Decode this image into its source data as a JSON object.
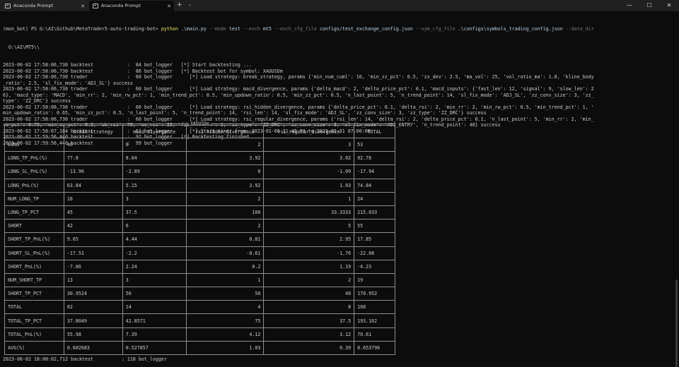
{
  "tabs": [
    {
      "label": "Anaconda Prompt",
      "active": false
    },
    {
      "label": "Anaconda Prompt",
      "active": true
    }
  ],
  "tabbar": {
    "new_tab": "+",
    "dropdown": "⌄"
  },
  "window_controls": {
    "minimize": "—",
    "maximize": "☐",
    "close": "✕"
  },
  "terminal": {
    "prompt": "(mon_bot) PS G:\\AI\\Github\\MetaTrader5-auto-trading-bot> ",
    "command_exe": "python",
    "command_parts": [
      {
        "t": " .\\main.py ",
        "k": "plain"
      },
      {
        "t": "--mode",
        "k": "arg"
      },
      {
        "t": " test ",
        "k": "plain"
      },
      {
        "t": "--exch",
        "k": "arg"
      },
      {
        "t": " mt5 ",
        "k": "plain"
      },
      {
        "t": "--exch_cfg_file",
        "k": "arg"
      },
      {
        "t": " configs/test_exchange_config.json ",
        "k": "plain"
      },
      {
        "t": "--sym_cfg_file",
        "k": "arg"
      },
      {
        "t": " .\\configs\\symbols_trading_config.json ",
        "k": "plain"
      },
      {
        "t": "--data_dir",
        "k": "arg"
      }
    ],
    "command_cont": "  G:\\AI\\MT5\\\\",
    "log_lines": [
      "2023-06-02 17:58:06,730 backtest            :  84 bot_logger   [*] Start backtesting ...",
      "2023-06-02 17:58:06,730 backtest            :  86 bot_logger   [*] Backtest bot for symbol: XAUUSDm",
      "2023-06-02 17:58:06,730 trader              :  60 bot_logger      [*] Load strategy: break_strategy, params {'min_num_cuml': 10, 'min_zz_pct': 0.5, 'zz_dev': 2.5, 'ma_vol': 25, 'vol_ratio_ma': 1.8, 'kline_body",
      "_ratio': 2.5, 'sl_fix_mode': 'ADJ_SL'} success",
      "2023-06-02 17:58:06,730 trader              :  60 bot_logger      [*] Load strategy: macd_divergence, params {'delta_macd': 2, 'delta_price_pct': 0.1, 'macd_inputs': {'fast_len': 12, 'signal': 9, 'slow_len': 2",
      "6}, 'macd_type': 'MACD', 'min_rr': 2, 'min_rw_pct': 1, 'min_trend_pct': 0.5, 'min_updown_ratio': 0.5, 'min_zz_pct': 0.5, 'n_last_point': 5, 'n_trend_point': 14, 'sl_fix_mode': 'ADJ_SL', 'zz_conv_size': 3, 'zz_",
      "type': 'ZZ_DRC'} success",
      "2023-06-02 17:58:06,730 trader              :  60 bot_logger      [*] Load strategy: rsi_hidden_divergence, params {'delta_price_pct': 0.1, 'delta_rsi': 2, 'min_rr': 2, 'min_rw_pct': 0.5, 'min_trend_pct': 1, '",
      "min_updown_ratio': 0.65, 'min_zz_pct': 0.5, 'n_last_point': 5, 'n_trend_point': 14, 'rsi_len': 14, 'sl_fix_mode': 'ADJ_SL', 'zz_conv_size': 3, 'zz_type': 'ZZ_DRC'} success",
      "2023-06-02 17:58:06,730 trader              :  60 bot_logger      [*] Load strategy: rsi_regular_divergence, params {'rsi_len': 14, 'delta_rsi': 2, 'delta_price_pct': 0.1, 'n_last_point': 5, 'min_rr': 2, 'min_",
      "rw_pct': 0.75, 'min_zz_pct': 0.5, 'ob_rsi': 70, 'os_rsi': 25, 'fib_retr_lv': 1, 'zz_type': 'ZZ_DRC', 'zz_conv_size': 3, 'sl_fix_mode': 'ADJ_ENTRY', 'n_trend_point': 40} success",
      "2023-06-02 17:58:07,184 backtest            :  61 bot_logger      [*] Start timer from: 2023-01-06 11:45:00 to 2023-05-31 07:00:00",
      "2023-06-02 17:59:56,440 backtest            :  92 bot_logger   [*] Backtesting finished",
      "2023-06-02 17:59:56,440 backtest            :  99 bot_logger"
    ],
    "final_line": "2023-06-02 18:00:02,712 backtest          : 118 bot_logger"
  },
  "table": {
    "title": "XAUUSDm",
    "headers": [
      "",
      "break_strategy",
      "macd_divergence",
      "rsi_hidden_divergence",
      "rsi_regular_divergence",
      "TOTAL"
    ],
    "rows": [
      [
        "LONG",
        "40",
        "8",
        "2",
        "3",
        "53"
      ],
      [
        "LONG_TP_PnL(%)",
        "77.8",
        "8.04",
        "3.92",
        "3.02",
        "92.78"
      ],
      [
        "LONG_SL_PnL(%)",
        "-13.96",
        "-2.89",
        "0",
        "-1.09",
        "-17.94"
      ],
      [
        "LONG_PnL(%)",
        "63.84",
        "5.15",
        "3.92",
        "1.93",
        "74.84"
      ],
      [
        "NUM_LONG_TP",
        "18",
        "3",
        "2",
        "1",
        "24"
      ],
      [
        "LONG_TP_PCT",
        "45",
        "37.5",
        "100",
        "33.3333",
        "215.833"
      ],
      [
        "SHORT",
        "42",
        "6",
        "2",
        "5",
        "55"
      ],
      [
        "SHORT_TP_PnL(%)",
        "9.65",
        "4.44",
        "0.81",
        "2.95",
        "17.85"
      ],
      [
        "SHORT_SL_PnL(%)",
        "-17.51",
        "-2.2",
        "-0.61",
        "-1.76",
        "-22.08"
      ],
      [
        "SHORT_PnL(%)",
        "-7.86",
        "2.24",
        "0.2",
        "1.19",
        "-4.23"
      ],
      [
        "NUM_SHORT_TP",
        "13",
        "3",
        "1",
        "2",
        "19"
      ],
      [
        "SHORT_TP_PCT",
        "30.9524",
        "50",
        "50",
        "40",
        "170.952"
      ],
      [
        "TOTAL",
        "82",
        "14",
        "4",
        "8",
        "108"
      ],
      [
        "TOTAL_TP_PCT",
        "37.8049",
        "42.8571",
        "75",
        "37.5",
        "193.162"
      ],
      [
        "TOTAL_PnL(%)",
        "55.98",
        "7.39",
        "4.12",
        "3.12",
        "70.61"
      ],
      [
        "AVG(%)",
        "0.682683",
        "0.527857",
        "1.03",
        "0.39",
        "0.653796"
      ]
    ]
  },
  "col_align": [
    "left",
    "left",
    "left",
    "right",
    "right",
    "left"
  ],
  "col_pad": [
    "",
    "    ",
    "",
    "",
    "",
    ""
  ]
}
